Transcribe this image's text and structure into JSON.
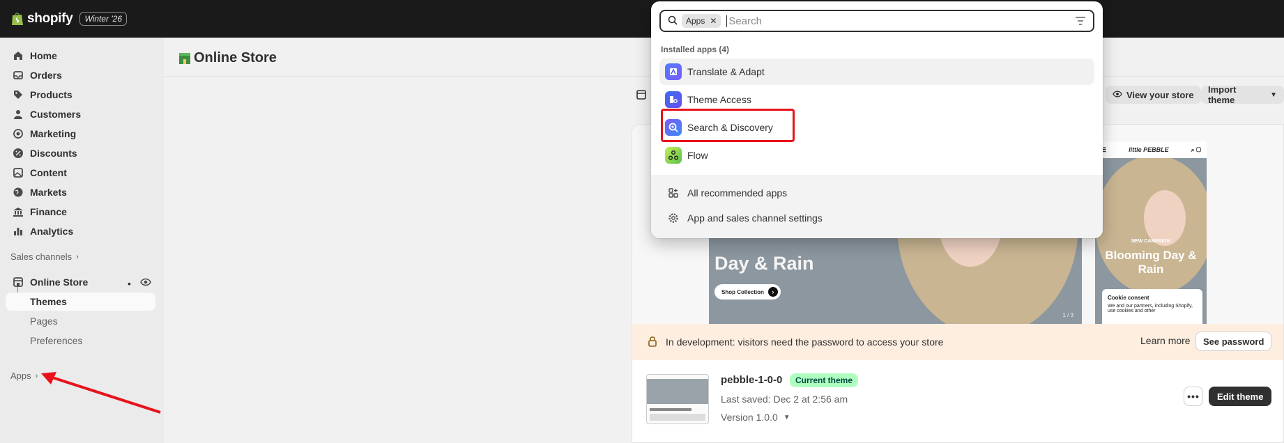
{
  "topbar": {
    "brand": "shopify",
    "edition": "Winter '26"
  },
  "sidebar": {
    "items": [
      {
        "label": "Home",
        "icon": "home-icon"
      },
      {
        "label": "Orders",
        "icon": "inbox-icon"
      },
      {
        "label": "Products",
        "icon": "tag-icon"
      },
      {
        "label": "Customers",
        "icon": "person-icon"
      },
      {
        "label": "Marketing",
        "icon": "target-icon"
      },
      {
        "label": "Discounts",
        "icon": "discount-icon"
      },
      {
        "label": "Content",
        "icon": "image-icon"
      },
      {
        "label": "Markets",
        "icon": "globe-icon"
      },
      {
        "label": "Finance",
        "icon": "bank-icon"
      },
      {
        "label": "Analytics",
        "icon": "bar-chart-icon"
      }
    ],
    "sales_channels_label": "Sales channels",
    "online_store": {
      "label": "Online Store",
      "sub_items": [
        "Themes",
        "Pages",
        "Preferences"
      ]
    },
    "apps_label": "Apps"
  },
  "page": {
    "title": "Online Store",
    "view_store_label": "View your store",
    "import_theme_label": "Import theme"
  },
  "preview": {
    "desktop_headline": "Day & Rain",
    "desktop_button": "Shop Collection",
    "desktop_pager": "1 / 3",
    "mobile_brand": "little PEBBLE",
    "mobile_campaign": "NEW CAMPAIGN",
    "mobile_title": "Blooming Day & Rain",
    "cookie_title": "Cookie consent",
    "cookie_text": "We and our partners, including Shopify, use cookies and other"
  },
  "dev_banner": {
    "message": "In development: visitors need the password to access your store",
    "learn_more": "Learn more",
    "see_password": "See password"
  },
  "current_theme": {
    "name": "pebble-1-0-0",
    "badge": "Current theme",
    "last_saved": "Last saved: Dec 2 at 2:56 am",
    "version": "Version 1.0.0",
    "edit_label": "Edit theme",
    "more_label": "•••"
  },
  "popover": {
    "chip_label": "Apps",
    "search_placeholder": "Search",
    "section_title": "Installed apps (4)",
    "apps": [
      {
        "label": "Translate & Adapt",
        "color": "#5b6cff"
      },
      {
        "label": "Theme Access",
        "color": "#4f7cff"
      },
      {
        "label": "Search & Discovery",
        "color": "#5a5ce6"
      },
      {
        "label": "Flow",
        "color": "#8fd14f"
      }
    ],
    "links": [
      "All recommended apps",
      "App and sales channel settings"
    ]
  },
  "colors": {
    "topbar_bg": "#1a1a1a",
    "highlight": "#e8121b",
    "badge_bg": "#affebf",
    "banner_bg": "#fdeee0"
  }
}
